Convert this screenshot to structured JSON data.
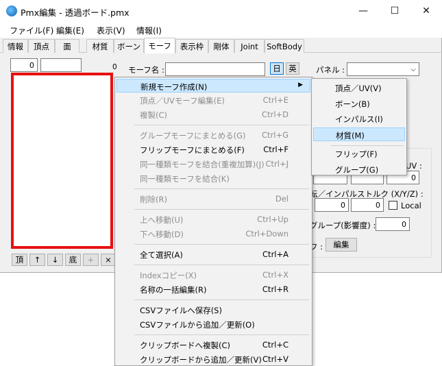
{
  "window": {
    "title": "Pmx編集 - 透過ボード.pmx",
    "controls": {
      "minimize": "—",
      "maximize": "☐",
      "close": "✕"
    }
  },
  "menubar": [
    "ファイル(F)",
    "編集(E)",
    "表示(V)",
    "情報(I)"
  ],
  "tabs": [
    "情報",
    "頂点",
    "面",
    "材質",
    "ボーン",
    "モーフ",
    "表示枠",
    "剛体",
    "Joint",
    "SoftBody"
  ],
  "active_tab": "モーフ",
  "left": {
    "index_value": "0",
    "name_value": "",
    "count_value": "0",
    "buttons": [
      "頂",
      "↑",
      "↓",
      "底",
      "+",
      "×"
    ]
  },
  "editor": {
    "morph_name_label": "モーフ名 :",
    "jp_button": "日",
    "en_button": "英",
    "panel_label": "パネル :",
    "uv_label": "UV :",
    "uv_value": "0",
    "rotation_label": "転／インパルストルク (X/Y/Z) :",
    "rot_values": [
      "0",
      "0"
    ],
    "local_label": "Local",
    "group_label": "グループ(影響度) :",
    "group_value": "0",
    "edit_prefix": "フ :",
    "edit_button": "編集"
  },
  "context_menu": [
    {
      "label": "新規モーフ作成(N)",
      "shortcut": "",
      "submenu": true,
      "state": "highlight"
    },
    {
      "label": "頂点／UVモーフ編集(E)",
      "shortcut": "Ctrl+E",
      "state": "disabled"
    },
    {
      "label": "複製(C)",
      "shortcut": "Ctrl+D",
      "state": "disabled"
    },
    {
      "sep": true
    },
    {
      "label": "グループモーフにまとめる(G)",
      "shortcut": "Ctrl+G",
      "state": "disabled"
    },
    {
      "label": "フリップモーフにまとめる(F)",
      "shortcut": "Ctrl+F",
      "state": "enabled"
    },
    {
      "label": "同一種類モーフを結合(重複加算)(J)",
      "shortcut": "Ctrl+J",
      "state": "disabled"
    },
    {
      "label": "同一種類モーフを結合(K)",
      "shortcut": "",
      "state": "disabled"
    },
    {
      "sep": true
    },
    {
      "label": "削除(R)",
      "shortcut": "Del",
      "state": "disabled"
    },
    {
      "sep": true
    },
    {
      "label": "上へ移動(U)",
      "shortcut": "Ctrl+Up",
      "state": "disabled"
    },
    {
      "label": "下へ移動(D)",
      "shortcut": "Ctrl+Down",
      "state": "disabled"
    },
    {
      "sep": true
    },
    {
      "label": "全て選択(A)",
      "shortcut": "Ctrl+A",
      "state": "enabled"
    },
    {
      "sep": true
    },
    {
      "label": "Indexコピー(X)",
      "shortcut": "Ctrl+X",
      "state": "disabled"
    },
    {
      "label": "名称の一括編集(R)",
      "shortcut": "Ctrl+R",
      "state": "enabled"
    },
    {
      "sep": true
    },
    {
      "label": "CSVファイルへ保存(S)",
      "shortcut": "",
      "state": "enabled"
    },
    {
      "label": "CSVファイルから追加／更新(O)",
      "shortcut": "",
      "state": "enabled"
    },
    {
      "sep": true
    },
    {
      "label": "クリップボードへ複製(C)",
      "shortcut": "Ctrl+C",
      "state": "enabled"
    },
    {
      "label": "クリップボードから追加／更新(V)",
      "shortcut": "Ctrl+V",
      "state": "enabled"
    }
  ],
  "submenu": [
    {
      "label": "頂点／UV(V)",
      "state": "enabled"
    },
    {
      "label": "ボーン(B)",
      "state": "enabled"
    },
    {
      "label": "インパルス(I)",
      "state": "enabled"
    },
    {
      "label": "材質(M)",
      "state": "highlight"
    },
    {
      "sep": true
    },
    {
      "label": "フリップ(F)",
      "state": "enabled"
    },
    {
      "label": "グループ(G)",
      "state": "enabled"
    }
  ],
  "colors": {
    "list_border": "#e81010",
    "highlight": "#cce8ff"
  }
}
